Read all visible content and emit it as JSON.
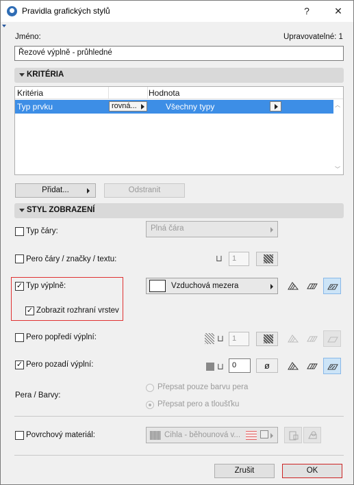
{
  "window": {
    "title": "Pravidla grafických stylů",
    "help_label": "?",
    "close_label": "✕"
  },
  "name": {
    "label": "Jméno:",
    "editable_label": "Upravovatelné: 1",
    "value": "Řezové výplně - průhledné"
  },
  "criteria": {
    "header": "KRITÉRIA",
    "columns": [
      "Kritéria",
      "Hodnota"
    ],
    "rows": [
      {
        "criterion": "Typ prvku",
        "operator": "rovná...",
        "value": "Všechny typy"
      }
    ],
    "add_label": "Přidat...",
    "remove_label": "Odstranit"
  },
  "display_style": {
    "header": "STYL ZOBRAZENÍ",
    "line_type": {
      "label": "Typ čáry:",
      "checked": false,
      "value": "Plná čára"
    },
    "pen_line": {
      "label": "Pero čáry / značky / textu:",
      "checked": false,
      "pen_value": "1"
    },
    "fill_type": {
      "label": "Typ výplně:",
      "checked": true,
      "value": "Vzduchová mezera"
    },
    "show_layer_boundaries": {
      "label": "Zobrazit rozhraní vrstev",
      "checked": true
    },
    "fill_fg_pen": {
      "label": "Pero popředí výplní:",
      "checked": false,
      "pen_value": "1"
    },
    "fill_bg_pen": {
      "label": "Pero pozadí výplní:",
      "checked": true,
      "pen_value": "0",
      "empty_symbol": "ø"
    },
    "pens_colors": {
      "label": "Pera / Barvy:",
      "options": [
        "Přepsat pouze barvu pera",
        "Přepsat pero a tloušťku"
      ],
      "selected": 1
    },
    "surface": {
      "label": "Povrchový materiál:",
      "checked": false,
      "value": "Cihla - běhounová v..."
    }
  },
  "footer": {
    "cancel_label": "Zrušit",
    "ok_label": "OK"
  }
}
